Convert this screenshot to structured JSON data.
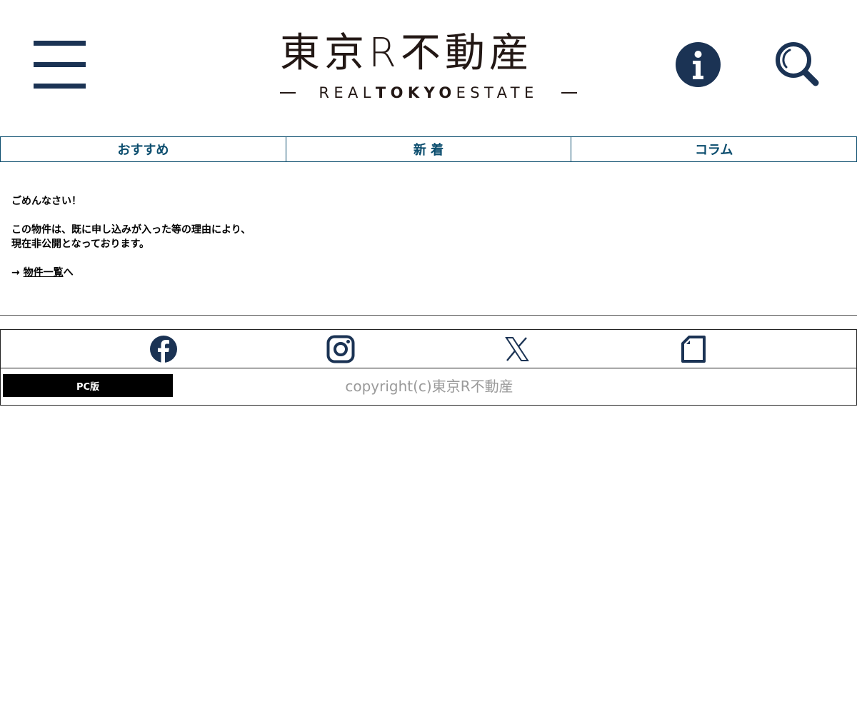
{
  "header": {
    "logo_jp": "東京R不動産",
    "logo_en_light_1": "REAL",
    "logo_en_bold": "TOKYO",
    "logo_en_light_2": "ESTATE",
    "info_glyph": "i"
  },
  "tabs": [
    {
      "label": "おすすめ"
    },
    {
      "label": "新 着"
    },
    {
      "label": "コラム"
    }
  ],
  "message": {
    "apology": "ごめんなさい！",
    "line1": "この物件は、既に申し込みが入った等の理由により、",
    "line2": "現在非公開となっております。",
    "arrow": "→ ",
    "link_label": "物件一覧",
    "link_suffix": "へ"
  },
  "footer": {
    "pc_label": "PC版",
    "copyright": "copyright(c)東京R不動産"
  },
  "colors": {
    "navy": "#1b3354",
    "tab_teal": "#0b4d6e",
    "copyright_gray": "#9a9a9a"
  },
  "icons": {
    "menu": "hamburger-menu-icon",
    "info": "info-icon",
    "search": "search-icon",
    "facebook": "facebook-icon",
    "instagram": "instagram-icon",
    "x": "x-twitter-icon",
    "note": "note-icon"
  }
}
